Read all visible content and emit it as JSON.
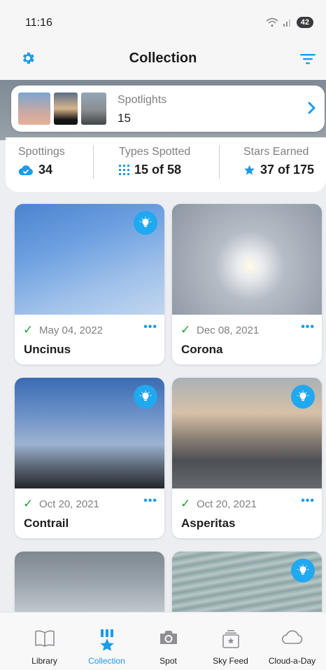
{
  "status": {
    "time": "11:16",
    "battery": "42"
  },
  "header": {
    "title": "Collection"
  },
  "spotlights": {
    "label": "Spotlights",
    "count": "15"
  },
  "stats": [
    {
      "label": "Spottings",
      "value": "34"
    },
    {
      "label": "Types Spotted",
      "value": "15 of 58"
    },
    {
      "label": "Stars Earned",
      "value": "37 of 175"
    }
  ],
  "cards": [
    {
      "date": "May 04, 2022",
      "name": "Uncinus",
      "more": "•••"
    },
    {
      "date": "Dec 08, 2021",
      "name": "Corona",
      "more": "•••"
    },
    {
      "date": "Oct 20, 2021",
      "name": "Contrail",
      "more": "•••"
    },
    {
      "date": "Oct 20, 2021",
      "name": "Asperitas",
      "more": "•••"
    }
  ],
  "tabs": [
    {
      "label": "Library"
    },
    {
      "label": "Collection"
    },
    {
      "label": "Spot"
    },
    {
      "label": "Sky Feed"
    },
    {
      "label": "Cloud-a-Day"
    }
  ],
  "colors": {
    "accent": "#1c9be8",
    "badge": "#20a8f0",
    "check": "#22a038"
  }
}
